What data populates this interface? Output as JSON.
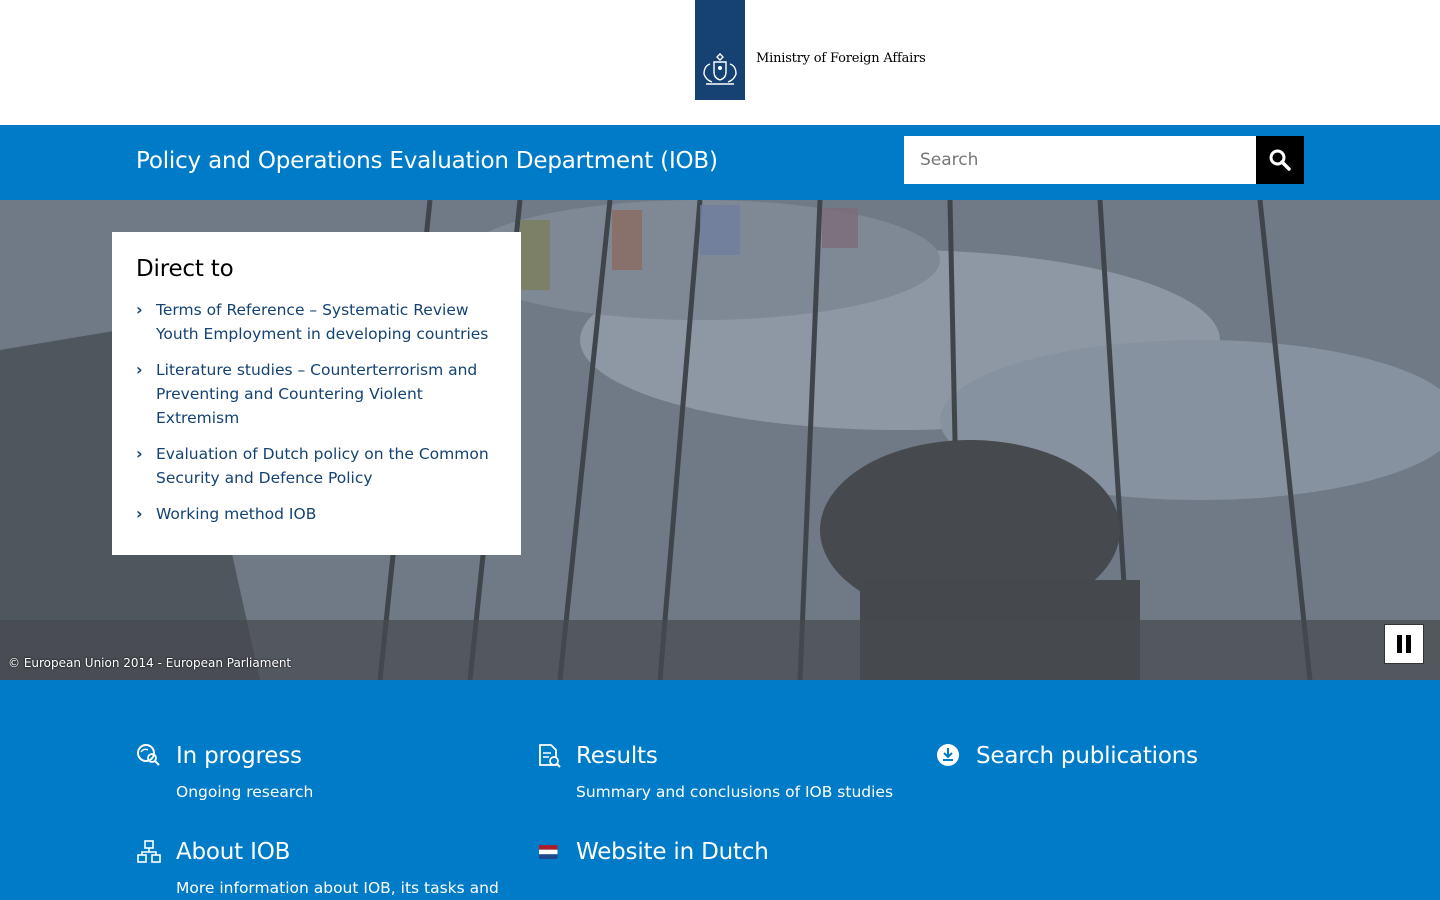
{
  "header": {
    "logo_text": "Ministry of Foreign Affairs"
  },
  "banner": {
    "title": "Policy and Operations Evaluation Department (IOB)",
    "search_placeholder": "Search",
    "search_icon": "search-icon"
  },
  "hero": {
    "credit": "© European Union 2014 - European Parliament",
    "pause_icon": "pause-icon"
  },
  "direct_to": {
    "heading": "Direct to",
    "links": [
      {
        "label": "Terms of Reference – Systematic Review Youth Employment in developing countries"
      },
      {
        "label": "Literature studies – Counterterrorism and Preventing and Countering Violent Extremism"
      },
      {
        "label": "Evaluation of Dutch policy on the Common Security and Defence Policy"
      },
      {
        "label": "Working method IOB"
      }
    ]
  },
  "tiles": [
    {
      "title": "In progress",
      "desc": "Ongoing research",
      "icon": "magnifier-icon"
    },
    {
      "title": "Results",
      "desc": "Summary and conclusions of IOB studies",
      "icon": "document-icon"
    },
    {
      "title": "Search publications",
      "desc": "",
      "icon": "download-icon"
    },
    {
      "title": "About IOB",
      "desc": "More information about IOB, its tasks and",
      "icon": "organisation-icon"
    },
    {
      "title": "Website in Dutch",
      "desc": "",
      "icon": "dutch-flag-icon"
    }
  ],
  "colors": {
    "brand_blue": "#007bc7",
    "logo_blue": "#154273",
    "link_blue": "#154273"
  }
}
